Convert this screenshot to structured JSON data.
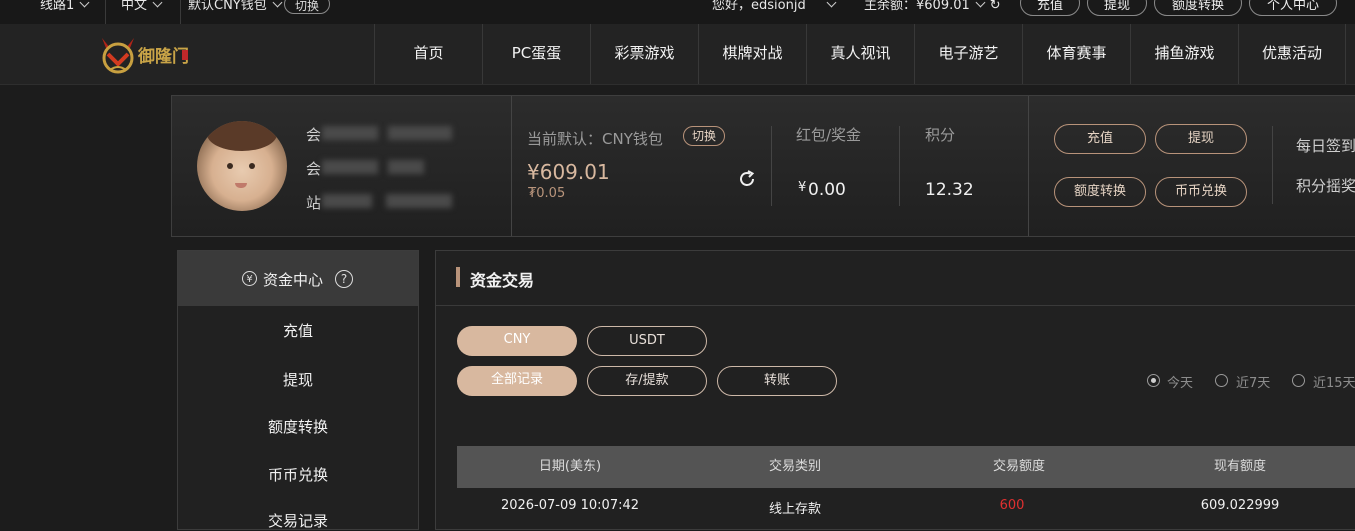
{
  "topbar": {
    "line": "线路1",
    "lang": "中文",
    "wallet_default": "默认CNY钱包",
    "switch": "切换",
    "greeting": "您好，edsionjd",
    "balance": "主余额：¥609.01",
    "buttons": [
      "充值",
      "提现",
      "额度转换",
      "个人中心"
    ]
  },
  "nav": {
    "logo_text": "御隆门",
    "items": [
      "首页",
      "PC蛋蛋",
      "彩票游戏",
      "棋牌对战",
      "真人视讯",
      "电子游艺",
      "体育赛事",
      "捕鱼游戏",
      "优惠活动"
    ]
  },
  "profile": {
    "labels": [
      "会",
      "会",
      "站"
    ],
    "current_default": "当前默认：CNY钱包",
    "switch": "切换",
    "amount": "¥609.01",
    "sub_amount": "₮0.05",
    "redpack_label": "红包/奖金",
    "redpack_currency": "¥",
    "redpack_value": "0.00",
    "points_label": "积分",
    "points_value": "12.32",
    "actions": [
      "充值",
      "提现",
      "额度转换",
      "币币兑换"
    ],
    "daily_signin": "每日签到",
    "points_lottery": "积分摇奖"
  },
  "sidebar": {
    "header": "资金中心",
    "currency_icon": "¥",
    "help_icon": "?",
    "items": [
      "充值",
      "提现",
      "额度转换",
      "币币兑换",
      "交易记录"
    ]
  },
  "main": {
    "title": "资金交易",
    "currency_tabs": [
      "CNY",
      "USDT"
    ],
    "record_tabs": [
      "全部记录",
      "存/提款",
      "转账"
    ],
    "date_filters": [
      "今天",
      "近7天",
      "近15天"
    ],
    "columns": [
      "日期(美东)",
      "交易类别",
      "交易额度",
      "现有额度"
    ],
    "rows": [
      [
        "2026-07-09 10:07:42",
        "线上存款",
        "600",
        "609.022999"
      ]
    ]
  },
  "colors": {
    "accent": "#d8b89f",
    "red": "#e03030"
  }
}
